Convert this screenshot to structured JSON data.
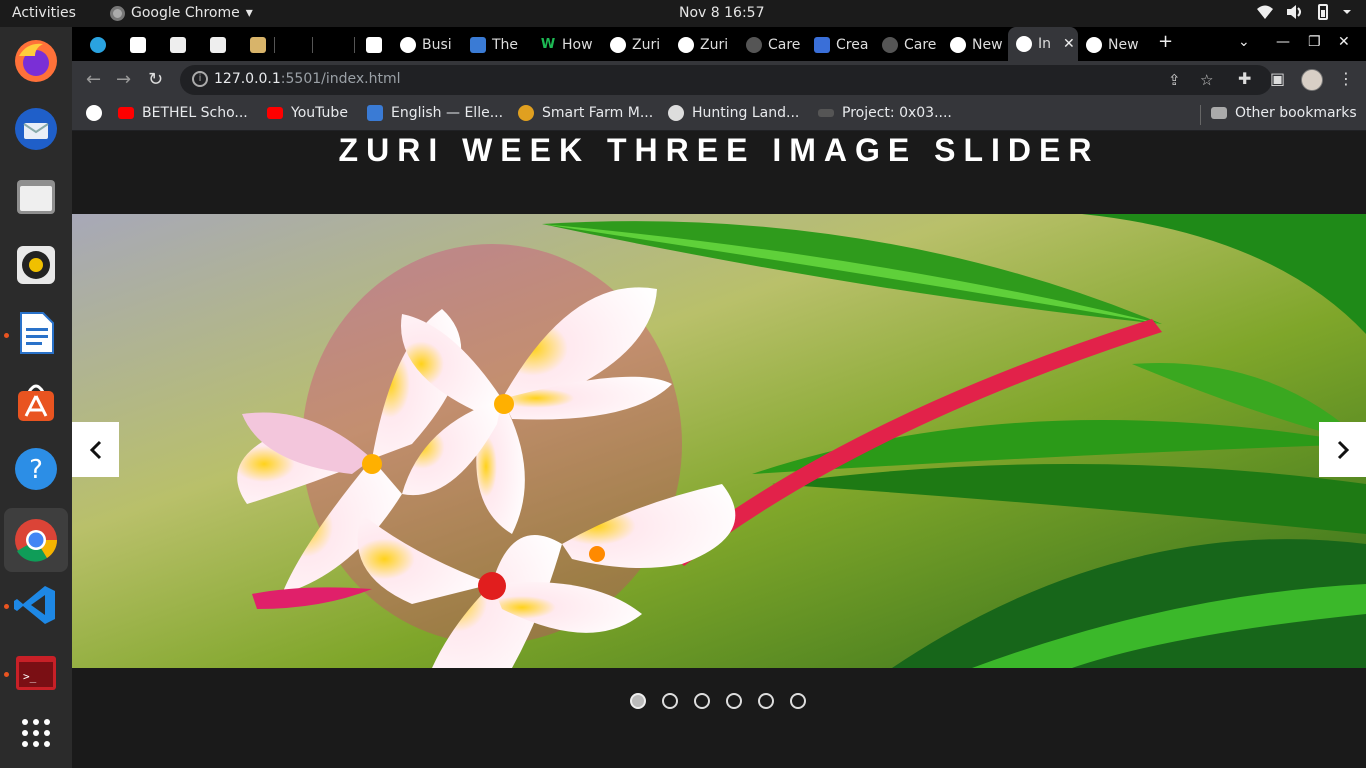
{
  "topbar": {
    "activities": "Activities",
    "app_name": "Google Chrome",
    "clock": "Nov 8  16:57"
  },
  "dock": {
    "items": [
      "firefox-icon",
      "thunderbird-icon",
      "files-icon",
      "rhythmbox-icon",
      "libreoffice-writer-icon",
      "software-icon",
      "help-icon",
      "chrome-icon",
      "vscode-icon",
      "terminal-icon",
      "app-grid-icon"
    ]
  },
  "tabs": [
    {
      "label": "",
      "icon": "telegram-icon"
    },
    {
      "label": "",
      "icon": "mg-icon"
    },
    {
      "label": "",
      "icon": "codesandbox-icon"
    },
    {
      "label": "",
      "icon": "codesandbox-icon"
    },
    {
      "label": "",
      "icon": "beer-icon"
    },
    {
      "label": "",
      "icon": "blank-icon"
    },
    {
      "label": "",
      "icon": "blank-icon"
    },
    {
      "label": "",
      "icon": "f-icon"
    },
    {
      "label": "Busi",
      "icon": "globe-icon"
    },
    {
      "label": "The",
      "icon": "site-icon"
    },
    {
      "label": "How",
      "icon": "w-icon"
    },
    {
      "label": "Zuri",
      "icon": "globe-icon"
    },
    {
      "label": "Zuri",
      "icon": "globe-icon"
    },
    {
      "label": "Care",
      "icon": "github-icon"
    },
    {
      "label": "Crea",
      "icon": "infinity-icon"
    },
    {
      "label": "Care",
      "icon": "github-icon"
    },
    {
      "label": "New",
      "icon": "chrome-icon"
    },
    {
      "label": "In",
      "icon": "globe-icon"
    },
    {
      "label": "New",
      "icon": "chrome-icon"
    }
  ],
  "address": {
    "host": "127.0.0.1",
    "rest": ":5501/index.html"
  },
  "bookmarks": [
    {
      "label": "",
      "icon": "globe-icon"
    },
    {
      "label": "BETHEL Scho...",
      "icon": "youtube-icon"
    },
    {
      "label": "YouTube",
      "icon": "youtube-icon"
    },
    {
      "label": "English — Elle...",
      "icon": "site-icon"
    },
    {
      "label": "Smart Farm M...",
      "icon": "sun-icon"
    },
    {
      "label": "Hunting Land...",
      "icon": "site-icon"
    },
    {
      "label": "Project: 0x03....",
      "icon": "alx-icon"
    }
  ],
  "other_bookmarks": "Other bookmarks",
  "page": {
    "title": "ZURI WEEK THREE IMAGE SLIDER",
    "slide_count": 6,
    "active_slide": 1
  }
}
